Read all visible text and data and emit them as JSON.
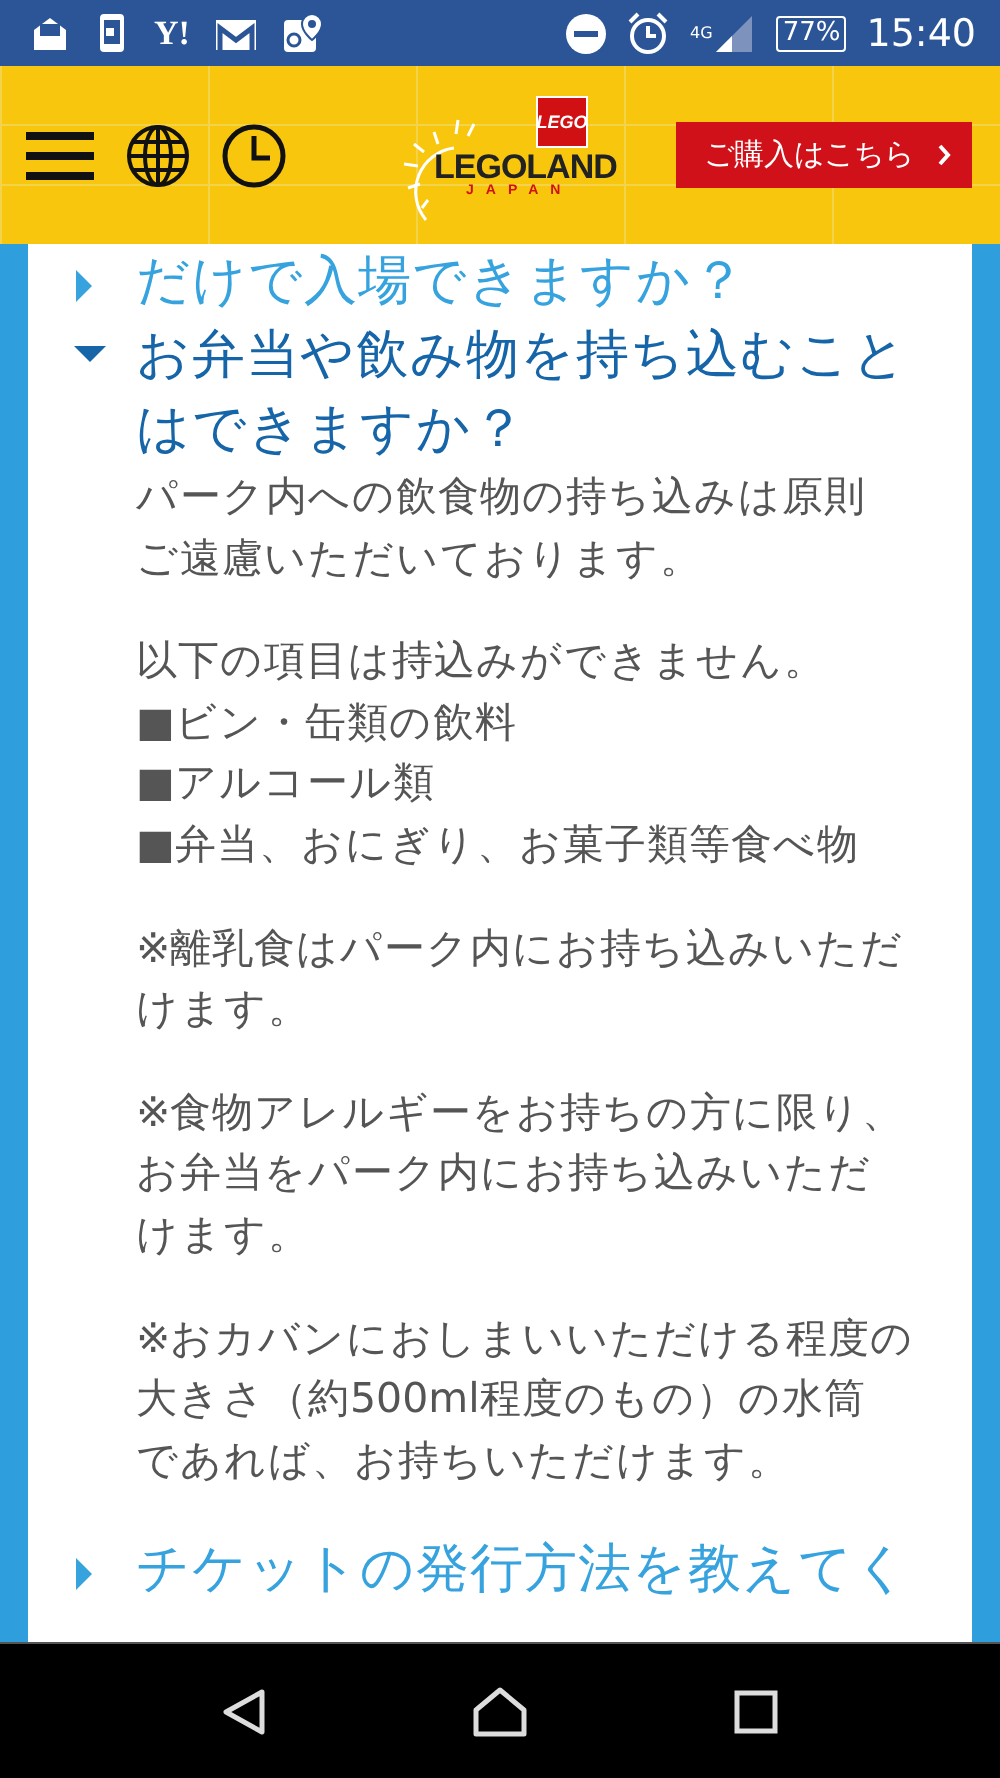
{
  "status_bar": {
    "left_icons_text": "Y!",
    "network": "4G",
    "battery": "77%",
    "time": "15:40"
  },
  "header": {
    "logo": {
      "brand": "LEGO",
      "name": "LEGOLAND",
      "sub": "JAPAN"
    },
    "buy_button": "ご購入はこちら"
  },
  "faq": [
    {
      "question": "だけで入場できますか？",
      "expanded": false
    },
    {
      "question": "お弁当や飲み物を持ち込むことはできますか？",
      "expanded": true,
      "answer": [
        {
          "lines": [
            "パーク内への飲食物の持ち込みは原則",
            "ご遠慮いただいております。"
          ]
        },
        {
          "lines": [
            "以下の項目は持込みができません。",
            "■ビン・缶類の飲料",
            "■アルコール類",
            "■弁当、おにぎり、お菓子類等食べ物"
          ]
        },
        {
          "lines": [
            "※離乳食はパーク内にお持ち込みいただ",
            "けます。"
          ]
        },
        {
          "lines": [
            "※食物アレルギーをお持ちの方に限り、",
            "お弁当をパーク内にお持ち込みいただ",
            "けます。"
          ]
        },
        {
          "lines": [
            "※おカバンにおしまいいただける程度の",
            "大きさ（約500ml程度のもの）の水筒",
            "であれば、お持ちいただけます。"
          ]
        }
      ]
    },
    {
      "question": "チケットの発行方法を教えてく",
      "expanded": false
    }
  ]
}
